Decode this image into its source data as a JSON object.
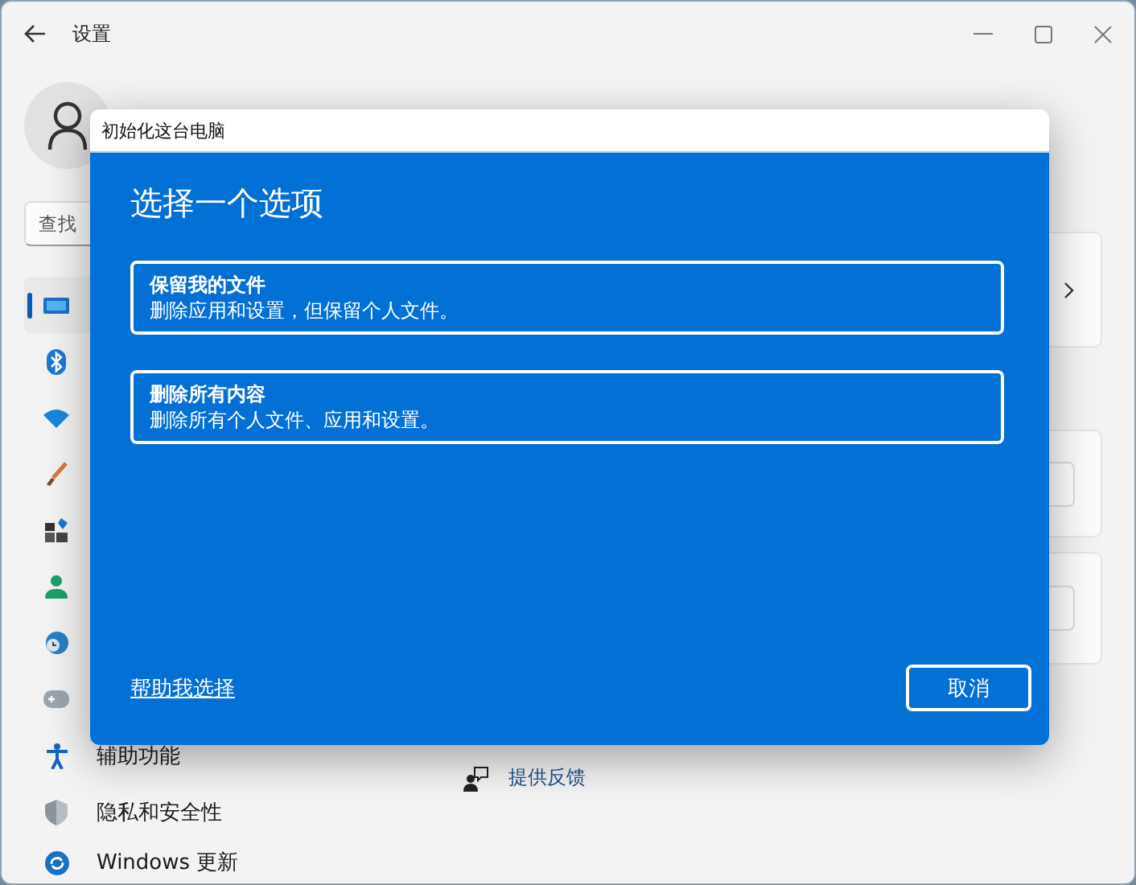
{
  "window": {
    "title": "设置"
  },
  "search": {
    "placeholder": "查找"
  },
  "sidebar": {
    "items": [
      {
        "selected": true
      },
      {
        "selected": false
      },
      {
        "selected": false
      },
      {
        "selected": false
      },
      {
        "selected": false
      },
      {
        "selected": false
      },
      {
        "selected": false
      },
      {
        "selected": false
      },
      {
        "label": "辅助功能",
        "selected": false
      },
      {
        "label": "隐私和安全性",
        "selected": false
      },
      {
        "label": "Windows 更新",
        "selected": false
      }
    ]
  },
  "cards": [
    {
      "kind": "link"
    },
    {
      "kind": "button"
    },
    {
      "kind": "button"
    }
  ],
  "feedback": {
    "label": "提供反馈"
  },
  "dialog": {
    "title": "初始化这台电脑",
    "heading": "选择一个选项",
    "options": [
      {
        "title": "保留我的文件",
        "description": "删除应用和设置，但保留个人文件。"
      },
      {
        "title": "删除所有内容",
        "description": "删除所有个人文件、应用和设置。"
      }
    ],
    "help_link": "帮助我选择",
    "cancel_button": "取消"
  }
}
